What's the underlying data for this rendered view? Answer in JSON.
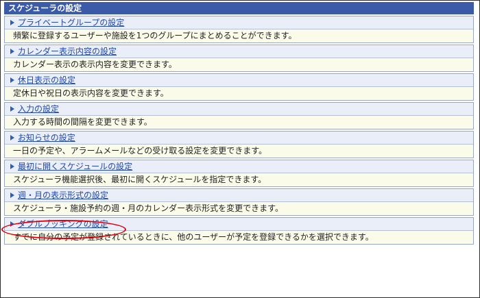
{
  "header": {
    "title": "スケジューラの設定"
  },
  "items": [
    {
      "label": "プライベートグループの設定",
      "desc": "頻繁に登録するユーザーや施設を1つのグループにまとめることができます。"
    },
    {
      "label": "カレンダー表示内容の設定",
      "desc": "カレンダー表示の表示内容を変更できます。"
    },
    {
      "label": "休日表示の設定",
      "desc": "定休日や祝日の表示内容を変更できます。"
    },
    {
      "label": "入力の設定",
      "desc": "入力する時間の間隔を変更できます。"
    },
    {
      "label": "お知らせの設定",
      "desc": "一日の予定や、アラームメールなどの受け取る設定を変更できます。"
    },
    {
      "label": "最初に開くスケジュールの設定",
      "desc": "スケジューラ機能選択後、最初に開くスケジュールを指定できます。"
    },
    {
      "label": "週・月の表示形式の設定",
      "desc": "スケジューラ・施設予約の週・月のカレンダー表示形式を変更できます。"
    },
    {
      "label": "ダブルブッキングの設定",
      "desc": "すでに自分の予定が登録されているときに、他のユーザーが予定を登録できるかを選択できます。"
    }
  ],
  "colors": {
    "header_bg": "#3b5aa8",
    "highlight": "#e0000d",
    "link": "#2248a8"
  }
}
